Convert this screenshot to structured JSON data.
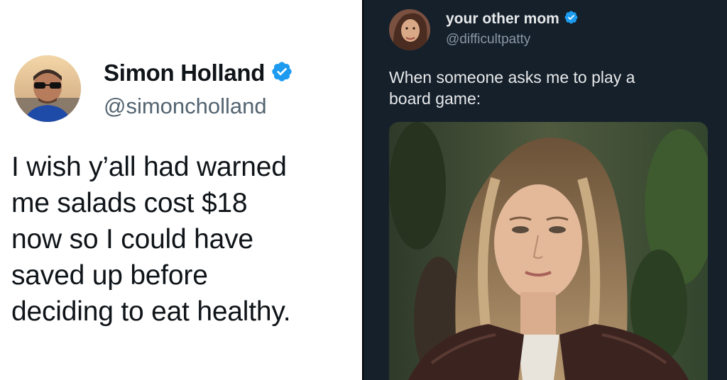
{
  "left_tweet": {
    "display_name": "Simon Holland",
    "handle": "@simoncholland",
    "verified_icon": "verified-badge-icon",
    "text_lines": [
      "I wish y’all had warned",
      "me salads cost $18",
      "now so I could have",
      "saved up before",
      "deciding to eat healthy."
    ],
    "colors": {
      "background": "#ffffff",
      "name": "#0f1419",
      "handle": "#536471",
      "badge": "#1d9bf0"
    }
  },
  "right_tweet": {
    "display_name": "your other mom",
    "handle": "@difficultpatty",
    "verified_icon": "verified-badge-icon",
    "text_lines": [
      "When someone asks me to play a",
      "board game:"
    ],
    "media": "photo",
    "colors": {
      "background": "#15202b",
      "name": "#e7e9ea",
      "handle": "#8b98a5",
      "badge": "#1d9bf0"
    }
  }
}
